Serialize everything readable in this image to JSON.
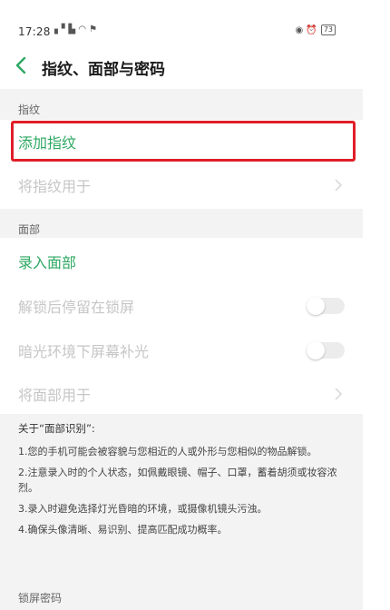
{
  "status_bar": {
    "time": "17:28",
    "left_icons": "▖▘▙ ◠ ⚑",
    "right_icons": "◉ ⏰",
    "battery": "73"
  },
  "app_bar": {
    "title": "指纹、面部与密码"
  },
  "fingerprint_section": {
    "header": "指纹",
    "add_fingerprint": "添加指纹",
    "use_fingerprint_for": "将指纹用于"
  },
  "face_section": {
    "header": "面部",
    "enroll_face": "录入面部",
    "stay_on_lock_screen": "解锁后停留在锁屏",
    "low_light_fill": "暗光环境下屏幕补光",
    "use_face_for": "将面部用于"
  },
  "about_face": {
    "title": "关于“面部识别”:",
    "items": [
      "1.您的手机可能会被容貌与您相近的人或外形与您相似的物品解锁。",
      "2.注意录入时的个人状态，如佩戴眼镜、帽子、口罩，蓄着胡须或妆容浓烈。",
      "3.录入时避免选择灯光昏暗的环境，或摄像机镜头污浊。",
      "4.确保头像清晰、易识别、提高匹配成功概率。"
    ]
  },
  "lock_section": {
    "header": "锁屏密码"
  },
  "colors": {
    "accent_green": "#2ea862",
    "highlight_red": "#e01e2a",
    "disabled_text": "#c6c6c6",
    "section_bg": "#f3f3f3"
  },
  "icons": {
    "back": "chevron-left-icon",
    "chevron": "chevron-right-icon"
  }
}
